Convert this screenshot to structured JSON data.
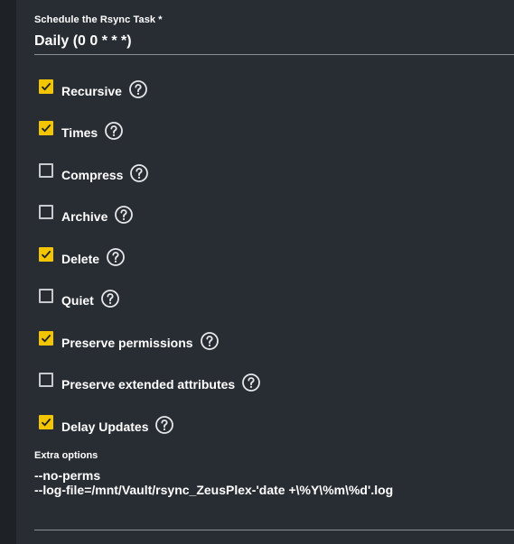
{
  "schedule": {
    "label": "Schedule the Rsync Task *",
    "value": "Daily (0 0 * * *)"
  },
  "options": [
    {
      "label": "Recursive",
      "checked": true
    },
    {
      "label": "Times",
      "checked": true
    },
    {
      "label": "Compress",
      "checked": false
    },
    {
      "label": "Archive",
      "checked": false
    },
    {
      "label": "Delete",
      "checked": true
    },
    {
      "label": "Quiet",
      "checked": false
    },
    {
      "label": "Preserve permissions",
      "checked": true
    },
    {
      "label": "Preserve extended attributes",
      "checked": false
    },
    {
      "label": "Delay Updates",
      "checked": true
    }
  ],
  "extra_options": {
    "label": "Extra options",
    "line1": "--no-perms",
    "line2": "--log-file=/mnt/Vault/rsync_ZeusPlex-'date +\\%Y\\%m\\%d'.log"
  },
  "colors": {
    "background": "#282c33",
    "accent": "#f2c500",
    "text": "#ffffff",
    "border": "#c7c9cc"
  },
  "icons": {
    "help": "help-circle-icon",
    "check": "checkmark-icon"
  }
}
